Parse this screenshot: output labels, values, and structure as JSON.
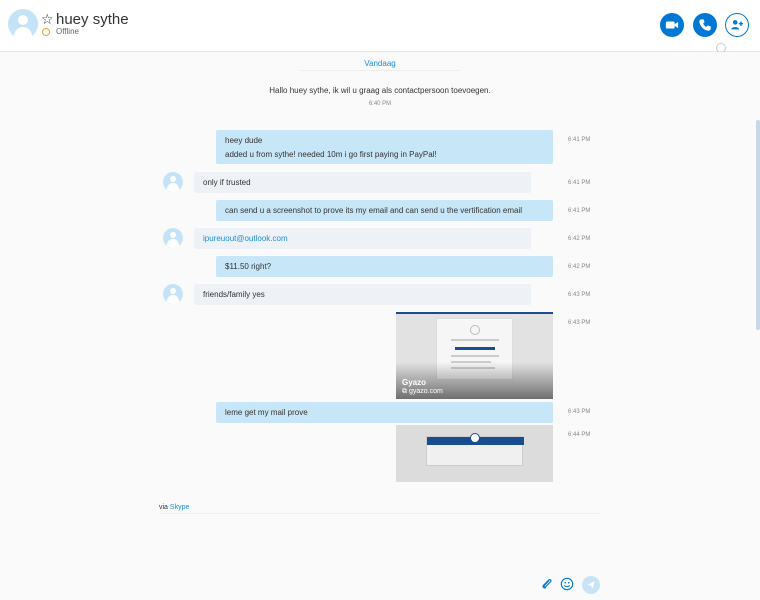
{
  "header": {
    "contact_name": "huey sythe",
    "status": "Offline"
  },
  "conversation": {
    "date_label": "Vandaag",
    "system_message": "Hallo huey sythe, ik wil u graag als contactpersoon toevoegen.",
    "system_time": "6:40 PM",
    "messages": [
      {
        "dir": "out",
        "lines": [
          "heey dude",
          "added u from sythe! needed 10m i go first paying in PayPal!"
        ],
        "time": "6:41 PM"
      },
      {
        "dir": "in",
        "text": "only if trusted",
        "time": "6:41 PM"
      },
      {
        "dir": "out",
        "text": "can send u a screenshot to prove its my email and can send u the vertification email",
        "time": "6:41 PM"
      },
      {
        "dir": "in",
        "text": "ipureuout@outlook.com",
        "time": "6:42 PM"
      },
      {
        "dir": "out",
        "text": "$11.50 right?",
        "time": "6:42 PM"
      },
      {
        "dir": "in",
        "text": "friends/family yes",
        "time": "6:43 PM"
      },
      {
        "dir": "out-preview",
        "site": "Gyazo",
        "url": "gyazo.com",
        "time": "6:43 PM"
      },
      {
        "dir": "out",
        "text": "leme get my mail prove",
        "time": "6:43 PM"
      },
      {
        "dir": "out-preview",
        "time": "6:44 PM"
      }
    ]
  },
  "footer": {
    "via_prefix": "via",
    "via_link": "Skype"
  },
  "colors": {
    "accent": "#0078d4",
    "outgoing_bubble": "#c7e6f8",
    "incoming_bubble": "#eef1f6",
    "link": "#1a8fd9",
    "status_offline": "#f0a030"
  },
  "icons": {
    "video_call": "video-icon",
    "audio_call": "phone-icon",
    "add_people": "add-person-icon",
    "attach": "paperclip-icon",
    "emoticon": "emoji-icon",
    "send": "send-icon"
  }
}
